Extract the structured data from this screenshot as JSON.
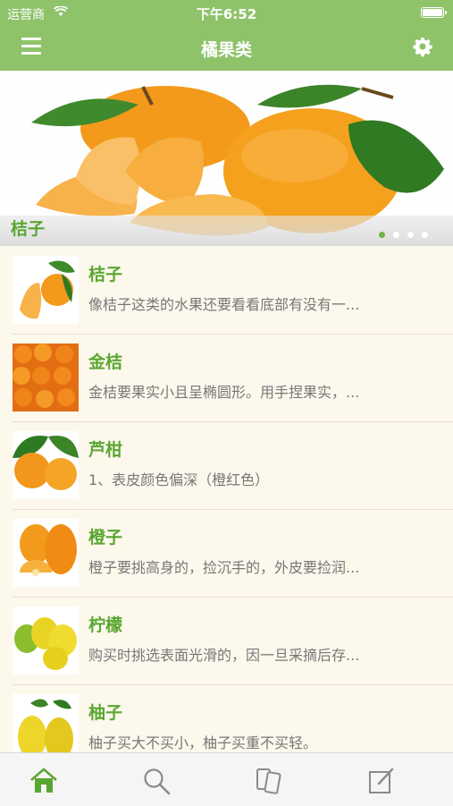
{
  "status_bar": {
    "carrier": "运营商",
    "time": "下午6:52"
  },
  "nav": {
    "title": "橘果类",
    "menu_icon": "hamburger-menu-icon",
    "settings_icon": "gear-icon"
  },
  "banner": {
    "caption": "桔子",
    "page_count": 4,
    "active_page": 1
  },
  "fruits": [
    {
      "name": "桔子",
      "desc": "像桔子这类的水果还要看看底部有没有一..."
    },
    {
      "name": "金桔",
      "desc": "金桔要果实小且呈椭圆形。用手捏果实，..."
    },
    {
      "name": "芦柑",
      "desc": "1、表皮颜色偏深（橙红色）"
    },
    {
      "name": "橙子",
      "desc": "橙子要挑高身的，捡沉手的，外皮要捡润..."
    },
    {
      "name": "柠檬",
      "desc": "购买时挑选表面光滑的，因一旦采摘后存..."
    },
    {
      "name": "柚子",
      "desc": "柚子买大不买小，柚子买重不买轻。"
    }
  ],
  "tabbar": {
    "tabs": [
      "home-icon",
      "search-icon",
      "cards-icon",
      "edit-icon"
    ],
    "active_color": "#5aa632",
    "inactive_color": "#8a8a8a"
  },
  "colors": {
    "header": "#8fc36a",
    "accent": "#5aa632",
    "background": "#fdf8ec"
  }
}
